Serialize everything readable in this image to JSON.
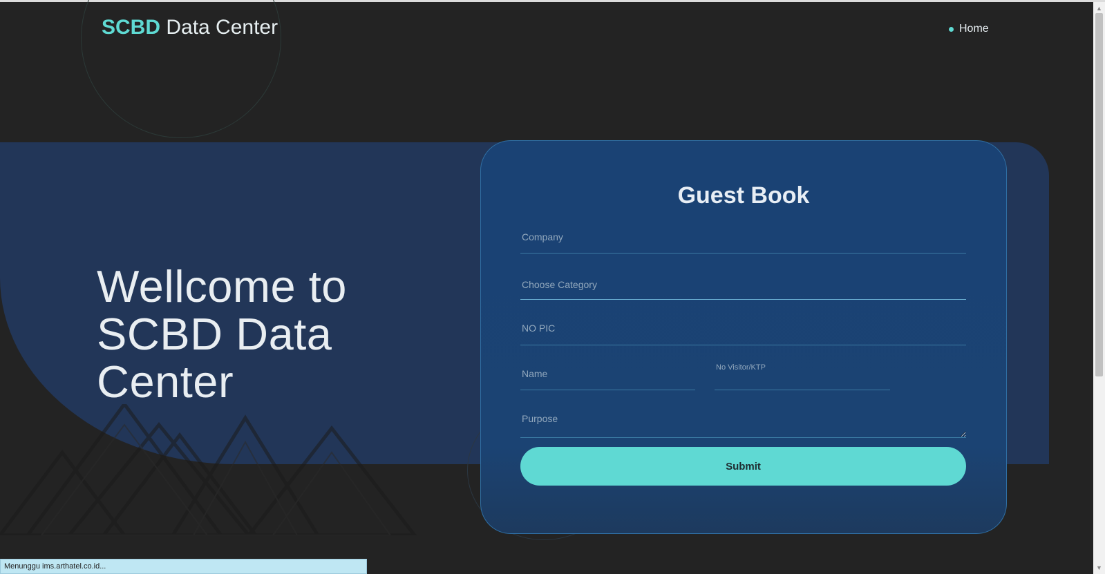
{
  "header": {
    "brand_strong": "SCBD",
    "brand_rest": " Data Center",
    "nav": {
      "home_label": "Home"
    }
  },
  "hero": {
    "welcome_text": "Wellcome to SCBD Data Center"
  },
  "form": {
    "title": "Guest Book",
    "company_placeholder": "Company",
    "category_placeholder": "Choose Category",
    "nopic_placeholder": "NO PIC",
    "name_placeholder": "Name",
    "visitor_placeholder": "No Visitor/KTP",
    "purpose_placeholder": "Purpose",
    "submit_label": "Submit"
  },
  "status_bar": {
    "text": "Menunggu ims.arthatel.co.id..."
  },
  "colors": {
    "accent": "#5fdad3",
    "background": "#232323",
    "band": "#223658",
    "card": "#1a4274"
  }
}
